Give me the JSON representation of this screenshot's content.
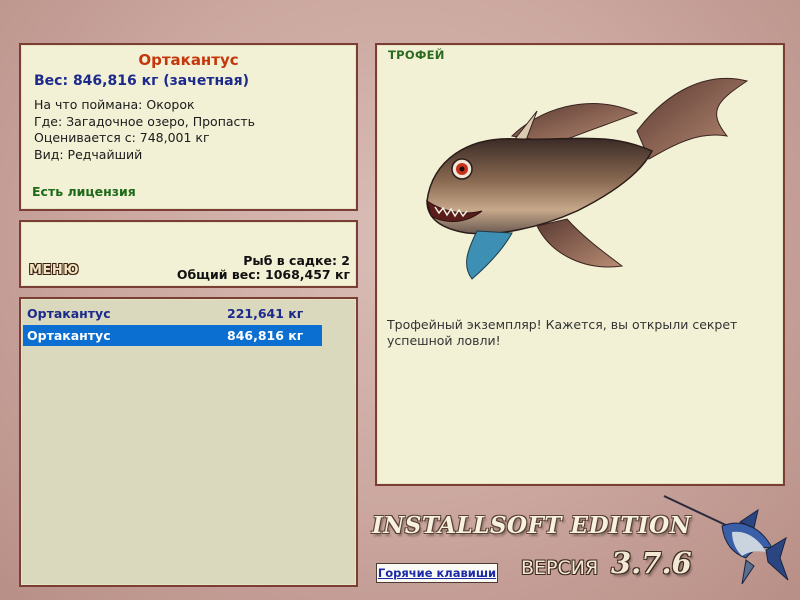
{
  "catch": {
    "name": "Ортакантус",
    "weight_line": "Вес: 846,816 кг (зачетная)",
    "bait": "На что поймана: Окорок",
    "location": "Где: Загадочное озеро, Пропасть",
    "valued_from": "Оценивается с: 748,001 кг",
    "rarity": "Вид: Редчайший",
    "license": "Есть лицензия"
  },
  "stats": {
    "menu_label": "МЕНЮ",
    "fish_in_net": "Рыб в садке: 2",
    "total_weight": "Общий вес: 1068,457 кг"
  },
  "keepnet": {
    "rows": [
      {
        "name": "Ортакантус",
        "weight": "221,641 кг",
        "selected": false
      },
      {
        "name": "Ортакантус",
        "weight": "846,816 кг",
        "selected": true
      }
    ]
  },
  "trophy": {
    "label": "ТРОФЕЙ",
    "message": "Трофейный экземпляр! Кажется, вы открыли секрет успешной ловли!"
  },
  "footer": {
    "edition": "INSTALLSOFT EDITION",
    "version_label": "ВЕРСИЯ",
    "version": "3.7.6",
    "hotkeys": "Горячие клавиши"
  },
  "colors": {
    "panel_bg": "#f2f1d6",
    "panel_border": "#7a3e34",
    "selection": "#0a6fd0",
    "name_color": "#c4370c",
    "weight_color": "#1c2a8c",
    "license_color": "#1e6a18"
  }
}
